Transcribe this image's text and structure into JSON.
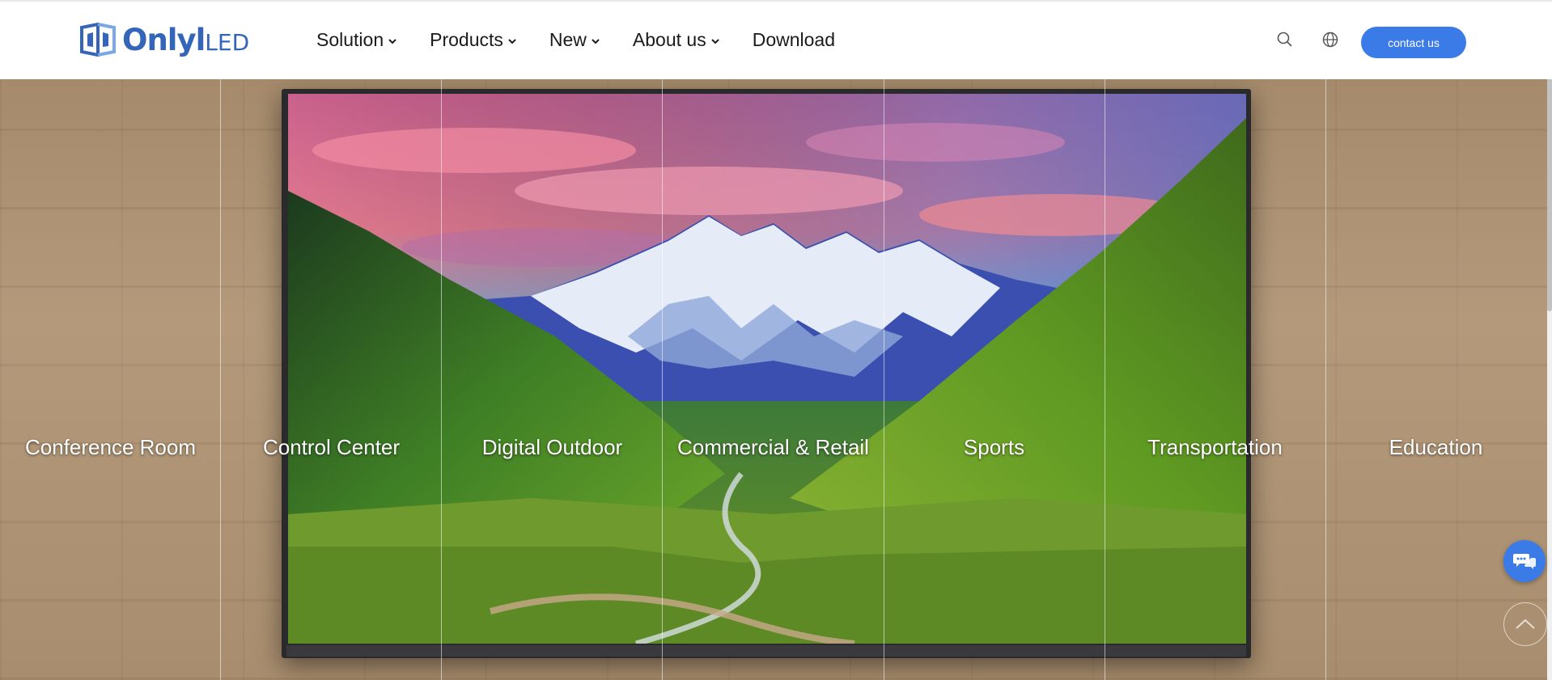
{
  "brand": {
    "logo_text_main": "Onlyl",
    "logo_text_led": "LED",
    "logo_alt": "OnlyLED",
    "color": "#3465b8"
  },
  "nav": {
    "items": [
      {
        "label": "Solution",
        "dropdown": true
      },
      {
        "label": "Products",
        "dropdown": true
      },
      {
        "label": "New",
        "dropdown": true
      },
      {
        "label": "About us",
        "dropdown": true
      },
      {
        "label": "Download",
        "dropdown": false
      }
    ]
  },
  "header_icons": {
    "search": "search-icon",
    "language": "globe-icon"
  },
  "contact": {
    "label": "contact us",
    "color": "#3b7be8"
  },
  "solutions": [
    "Conference Room",
    "Control Center",
    "Digital Outdoor",
    "Commercial & Retail",
    "Sports",
    "Transportation",
    "Education"
  ],
  "widgets": {
    "chat": "chat-icon",
    "back_to_top": "chevron-up-icon"
  }
}
